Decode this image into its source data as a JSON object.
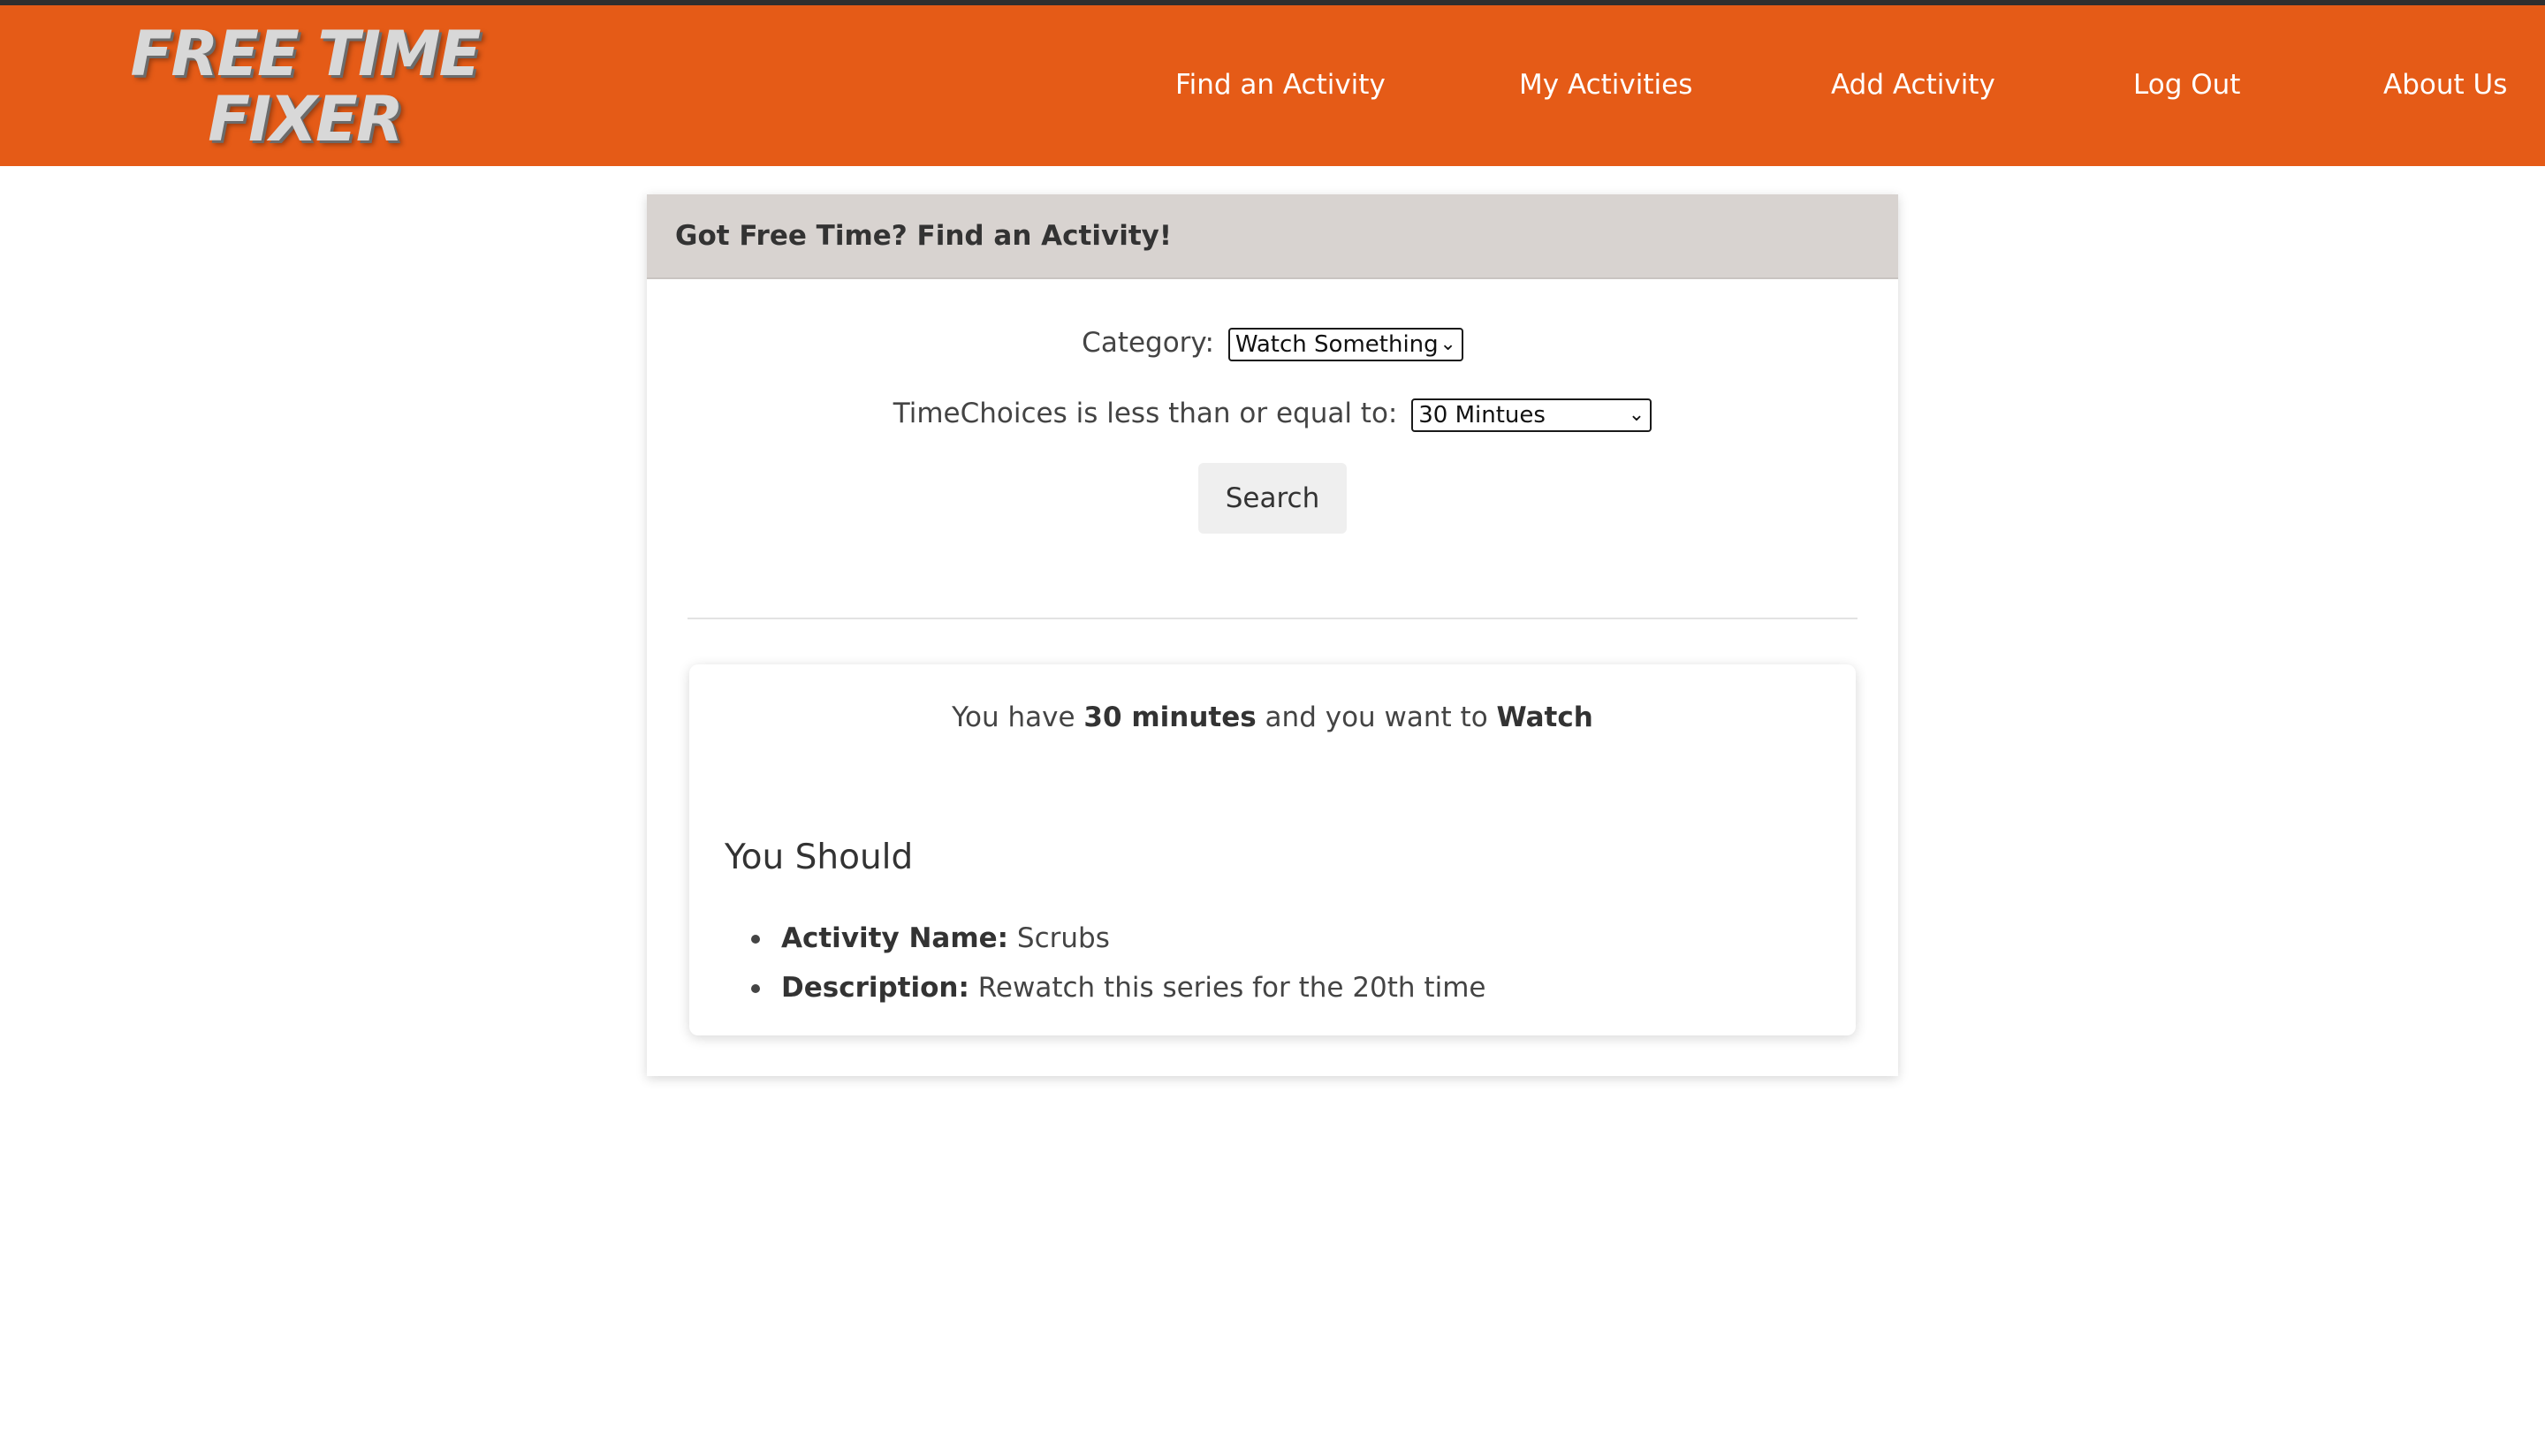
{
  "brand": {
    "logo_line1": "FREE TIME",
    "logo_line2": "FIXER",
    "accent_color": "#e55b17"
  },
  "nav": {
    "items": [
      {
        "label": "Find an Activity"
      },
      {
        "label": "My Activities"
      },
      {
        "label": "Add Activity"
      },
      {
        "label": "Log Out"
      },
      {
        "label": "About Us"
      }
    ]
  },
  "finder": {
    "header_title": "Got Free Time? Find an Activity!",
    "category_label": "Category:",
    "category_selected": "Watch Something",
    "time_label": "TimeChoices is less than or equal to:",
    "time_selected": "30 Mintues",
    "search_label": "Search"
  },
  "result": {
    "prefix": "You have",
    "time_value": "30 minutes",
    "middle": "and you want to",
    "category_value": "Watch",
    "heading": "You Should",
    "name_label": "Activity Name:",
    "name_value": "Scrubs",
    "description_label": "Description:",
    "description_value": "Rewatch this series for the 20th time"
  }
}
